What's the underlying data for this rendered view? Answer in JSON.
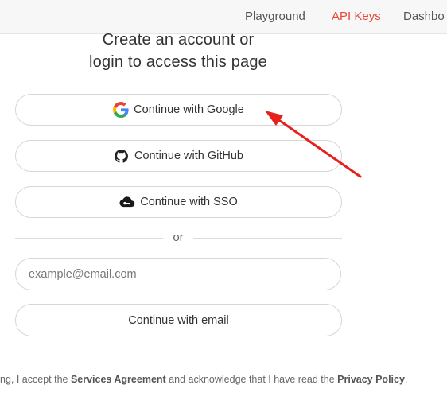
{
  "nav": {
    "items": [
      {
        "label": "Playground"
      },
      {
        "label": "API Keys",
        "active": true
      },
      {
        "label": "Dashbo"
      }
    ],
    "active_color": "#e5473a"
  },
  "heading": {
    "line1": "Create an account or",
    "line2": "login to access this page"
  },
  "auth_buttons": {
    "google": {
      "label": "Continue with Google",
      "icon": "google-icon"
    },
    "github": {
      "label": "Continue with GitHub",
      "icon": "github-icon"
    },
    "sso": {
      "label": "Continue with SSO",
      "icon": "cloud-key-icon"
    }
  },
  "divider": {
    "label": "or"
  },
  "email": {
    "placeholder": "example@email.com",
    "value": "",
    "submit_label": "Continue with email"
  },
  "legal": {
    "prefix": "ng, I accept the ",
    "services_link": "Services Agreement",
    "middle": " and acknowledge that I have read the ",
    "privacy_link": "Privacy Policy",
    "suffix": "."
  },
  "annotation": {
    "color": "#e8201c",
    "icon": "red-arrow"
  }
}
